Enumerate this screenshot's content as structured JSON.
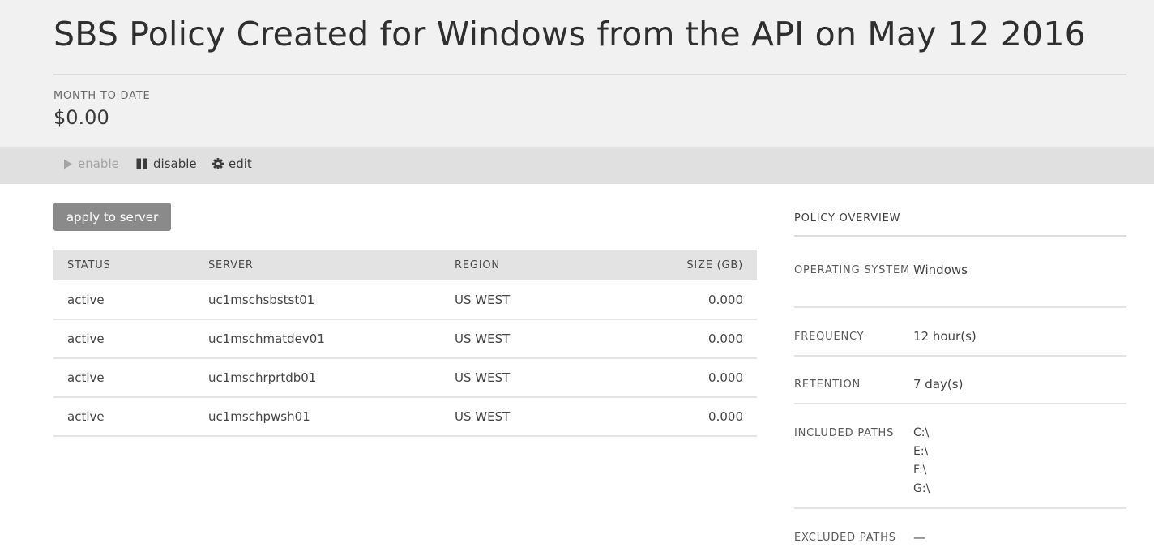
{
  "header": {
    "title": "SBS Policy Created for Windows from the API on May 12 2016",
    "month_to_date_label": "MONTH TO DATE",
    "month_to_date_value": "$0.00"
  },
  "toolbar": {
    "enable_label": "enable",
    "disable_label": "disable",
    "edit_label": "edit"
  },
  "actions": {
    "apply_label": "apply to server"
  },
  "table": {
    "columns": [
      "STATUS",
      "SERVER",
      "REGION",
      "SIZE (GB)"
    ],
    "rows": [
      {
        "status": "active",
        "server": "uc1mschsbstst01",
        "region": "US WEST",
        "size": "0.000"
      },
      {
        "status": "active",
        "server": "uc1mschmatdev01",
        "region": "US WEST",
        "size": "0.000"
      },
      {
        "status": "active",
        "server": "uc1mschrprtdb01",
        "region": "US WEST",
        "size": "0.000"
      },
      {
        "status": "active",
        "server": "uc1mschpwsh01",
        "region": "US WEST",
        "size": "0.000"
      }
    ]
  },
  "overview": {
    "title": "POLICY OVERVIEW",
    "os_label": "OPERATING SYSTEM",
    "os_value": "Windows",
    "frequency_label": "FREQUENCY",
    "frequency_value": "12 hour(s)",
    "retention_label": "RETENTION",
    "retention_value": "7 day(s)",
    "included_label": "INCLUDED PATHS",
    "included_paths": [
      "C:\\",
      "E:\\",
      "F:\\",
      "G:\\"
    ],
    "excluded_label": "EXCLUDED PATHS",
    "excluded_value": "—"
  },
  "icons": {
    "enable": "play-icon",
    "disable": "pause-icon",
    "edit": "gear-icon"
  },
  "colors": {
    "header_bg": "#f1f1f1",
    "toolbar_bg": "#e0e0e0",
    "button_bg": "#8a8a8a"
  }
}
